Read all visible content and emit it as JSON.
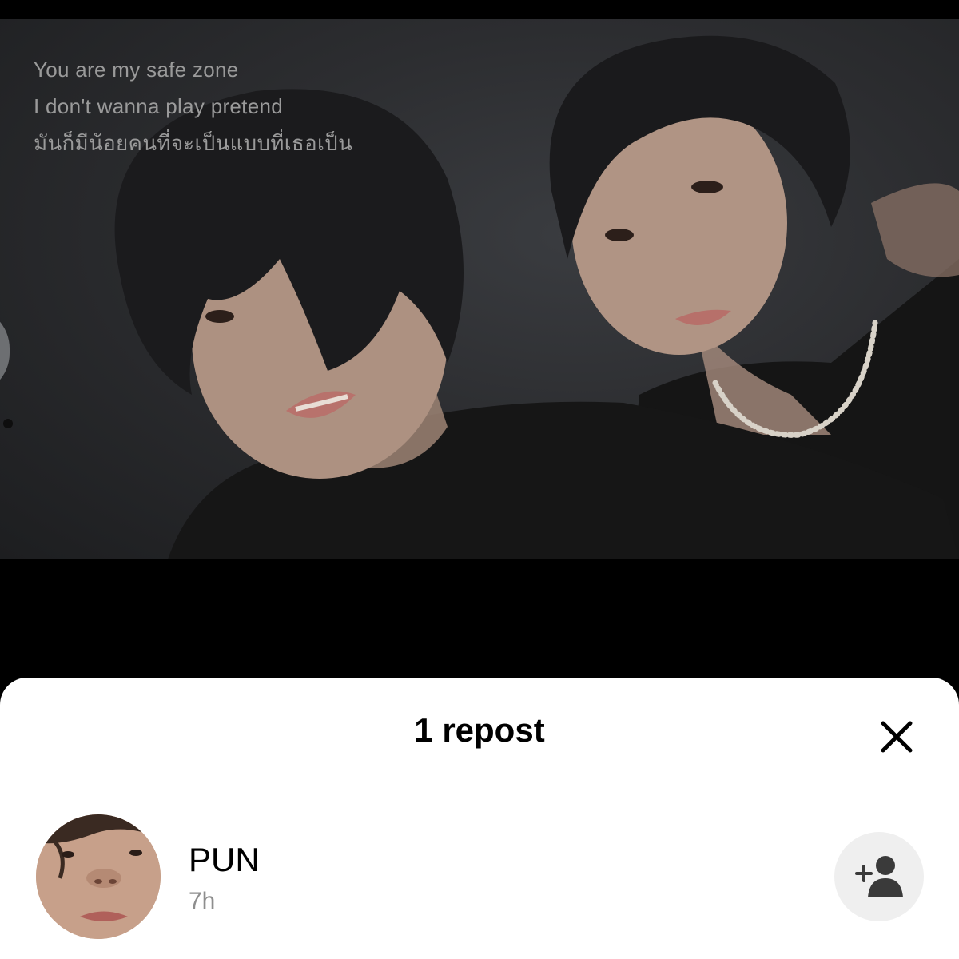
{
  "video": {
    "lyrics": [
      "You are my safe zone",
      "I don't wanna play pretend",
      "มันก็มีน้อยคนที่จะเป็นแบบที่เธอเป็น"
    ]
  },
  "sheet": {
    "title": "1 repost",
    "close_icon": "close-icon"
  },
  "reposters": [
    {
      "username": "PUN",
      "time": "7h",
      "action_icon": "add-user-icon"
    }
  ]
}
